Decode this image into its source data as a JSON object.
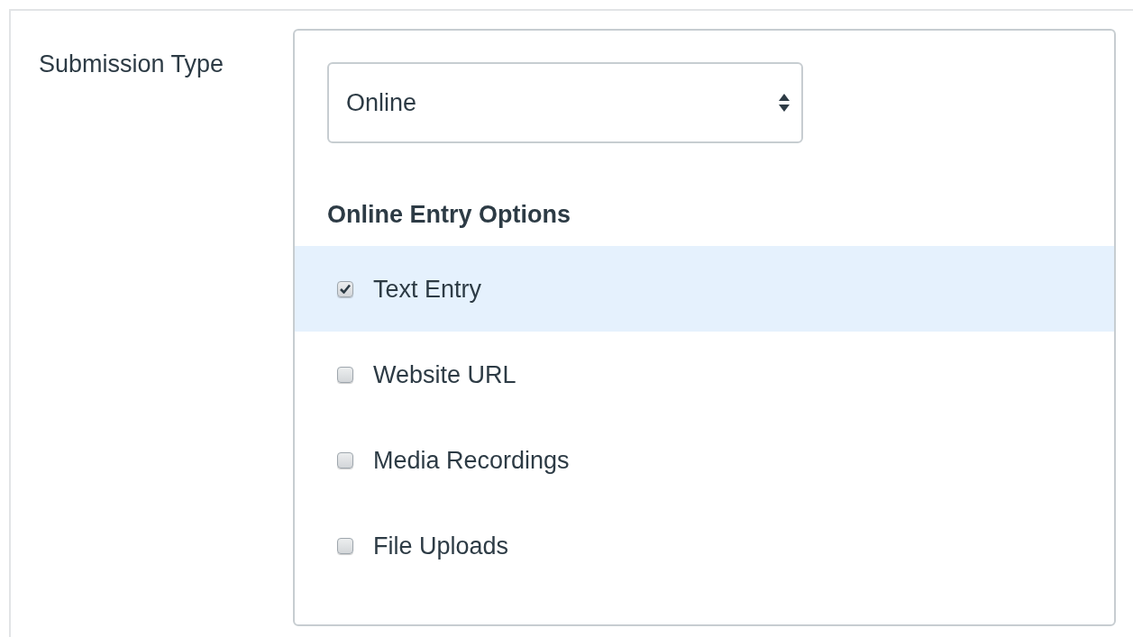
{
  "field_label": "Submission Type",
  "select": {
    "value": "Online"
  },
  "options_heading": "Online Entry Options",
  "options": [
    {
      "label": "Text Entry",
      "checked": true,
      "highlighted": true
    },
    {
      "label": "Website URL",
      "checked": false,
      "highlighted": false
    },
    {
      "label": "Media Recordings",
      "checked": false,
      "highlighted": false
    },
    {
      "label": "File Uploads",
      "checked": false,
      "highlighted": false
    }
  ]
}
